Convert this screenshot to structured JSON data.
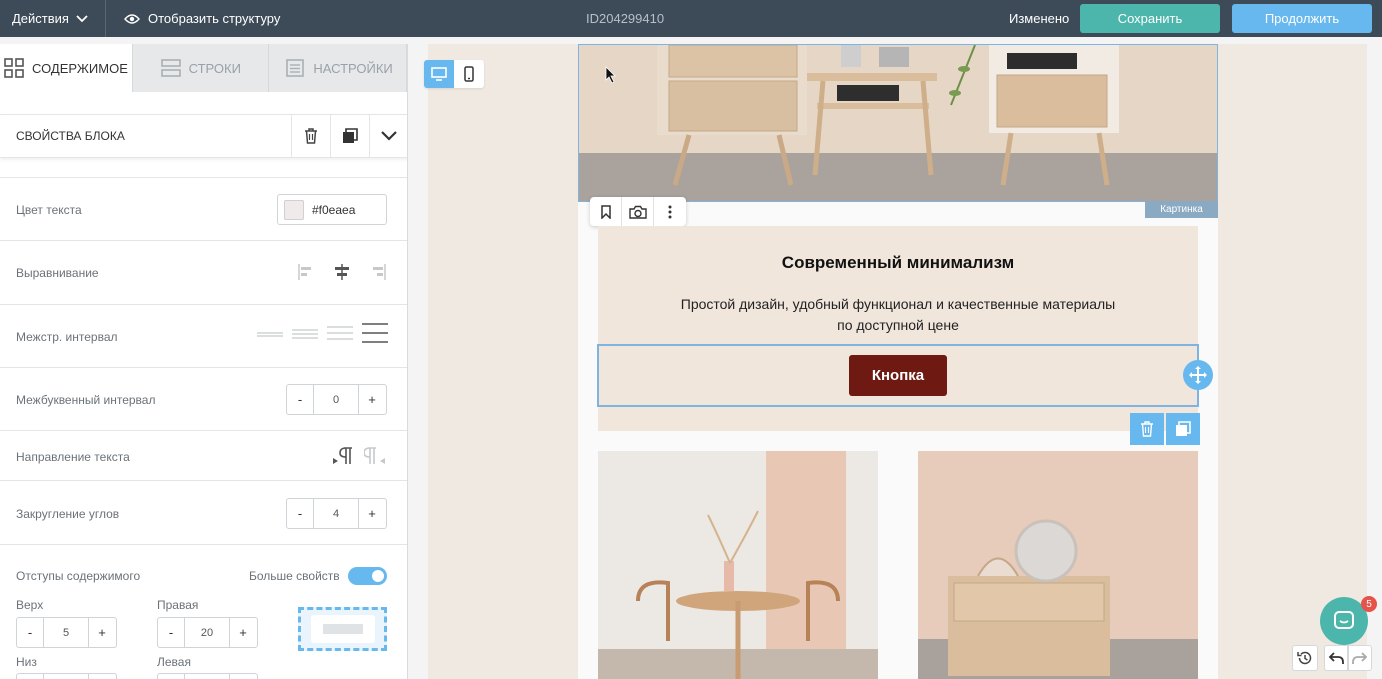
{
  "topbar": {
    "actions_label": "Действия",
    "structure_label": "Отобразить структуру",
    "doc_id": "ID204299410",
    "status": "Изменено",
    "save_label": "Сохранить",
    "continue_label": "Продолжить"
  },
  "tabs": [
    {
      "label": "Содержимое",
      "icon": "grid-icon",
      "active": true
    },
    {
      "label": "Строки",
      "icon": "rows-icon",
      "active": false
    },
    {
      "label": "Настройки",
      "icon": "settings-doc-icon",
      "active": false
    }
  ],
  "block_props": {
    "title": "Свойства блока",
    "text_color_label": "Цвет текста",
    "text_color_value": "#f0eaea",
    "alignment_label": "Выравнивание",
    "line_spacing_label": "Межстр. интервал",
    "letter_spacing_label": "Межбуквенный интервал",
    "letter_spacing_value": "0",
    "text_direction_label": "Направление текста",
    "corner_radius_label": "Закругление углов",
    "corner_radius_value": "4",
    "padding_label": "Отступы содержимого",
    "more_props_label": "Больше свойств",
    "more_props_on": true,
    "top_label": "Верх",
    "top_value": "5",
    "right_label": "Правая",
    "right_value": "20",
    "bottom_label": "Низ",
    "left_label": "Левая"
  },
  "stepper": {
    "minus": "-",
    "plus": "+"
  },
  "canvas": {
    "image_label": "Картинка",
    "heading": "Современный минимализм",
    "subtext_line1": "Простой дизайн, удобный функционал и качественные материалы",
    "subtext_line2": "по доступной цене",
    "button_label": "Кнопка",
    "button_color": "#6e1a12"
  },
  "chat": {
    "badge_count": "5"
  },
  "colors": {
    "topbar": "#3d4a57",
    "accent": "#66b8ee",
    "save": "#4db6ac"
  }
}
